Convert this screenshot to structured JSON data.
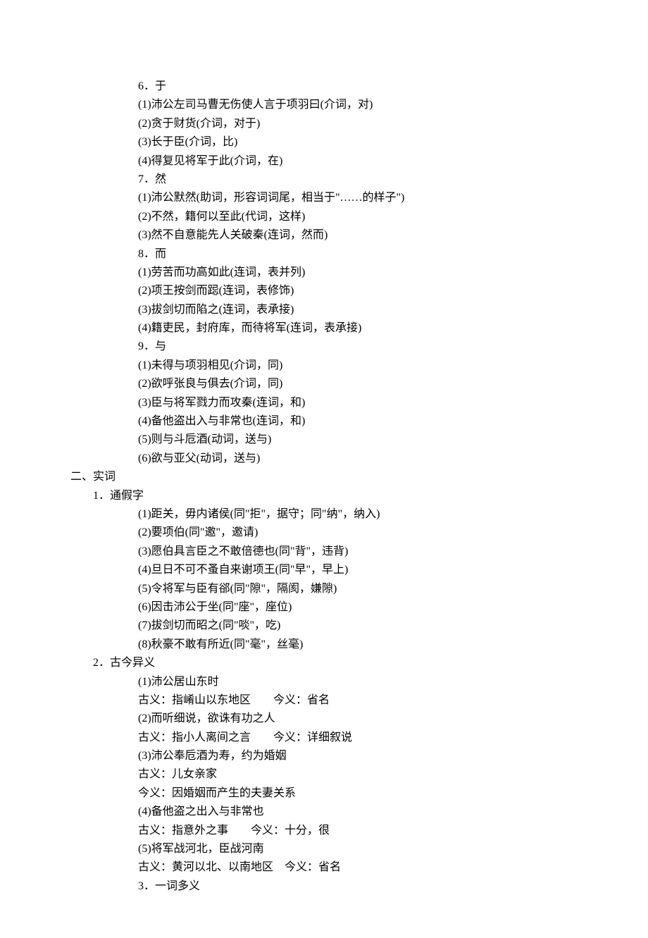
{
  "lines": [
    {
      "indent": 3,
      "text": "6．于"
    },
    {
      "indent": 3,
      "text": "(1)沛公左司马曹无伤使人言于项羽曰(介词，对)"
    },
    {
      "indent": 3,
      "text": "(2)贪于财货(介词，对于)"
    },
    {
      "indent": 3,
      "text": "(3)长于臣(介词，比)"
    },
    {
      "indent": 3,
      "text": "(4)得复见将军于此(介词，在)"
    },
    {
      "indent": 3,
      "text": "7．然"
    },
    {
      "indent": 3,
      "text": "(1)沛公默然(助词，形容词词尾，相当于\"……的样子\")"
    },
    {
      "indent": 3,
      "text": "(2)不然，籍何以至此(代词，这样)"
    },
    {
      "indent": 3,
      "text": "(3)然不自意能先人关破秦(连词，然而)"
    },
    {
      "indent": 3,
      "text": "8．而"
    },
    {
      "indent": 3,
      "text": "(1)劳苦而功高如此(连词，表并列)"
    },
    {
      "indent": 3,
      "text": "(2)项王按剑而跽(连词，表修饰)"
    },
    {
      "indent": 3,
      "text": "(3)拔剑切而陷之(连词，表承接)"
    },
    {
      "indent": 3,
      "text": "(4)籍吏民，封府库，而待将军(连词，表承接)"
    },
    {
      "indent": 3,
      "text": "9．与"
    },
    {
      "indent": 3,
      "text": "(1)未得与项羽相见(介词，同)"
    },
    {
      "indent": 3,
      "text": "(2)欲呼张良与俱去(介词，同)"
    },
    {
      "indent": 3,
      "text": "(3)臣与将军戮力而攻秦(连词，和)"
    },
    {
      "indent": 3,
      "text": "(4)备他盗出入与非常也(连词，和)"
    },
    {
      "indent": 3,
      "text": "(5)则与斗卮酒(动词，送与)"
    },
    {
      "indent": 3,
      "text": "(6)欲与亚父(动词，送与)"
    },
    {
      "indent": 0,
      "text": "二、实词"
    },
    {
      "indent": 1,
      "text": "1．通假字"
    },
    {
      "indent": 3,
      "text": "(1)距关，毋内诸侯(同\"拒\"，据守；同\"纳\"，纳入)"
    },
    {
      "indent": 3,
      "text": "(2)要项伯(同\"邀\"，邀请)"
    },
    {
      "indent": 3,
      "text": "(3)愿伯具言臣之不敢倍德也(同\"背\"，违背)"
    },
    {
      "indent": 3,
      "text": "(4)旦日不可不蚤自来谢项王(同\"早\"，早上)"
    },
    {
      "indent": 3,
      "text": "(5)令将军与臣有郤(同\"隙\"，隔阂，嫌隙)"
    },
    {
      "indent": 3,
      "text": "(6)因击沛公于坐(同\"座\"，座位)"
    },
    {
      "indent": 3,
      "text": "(7)拔剑切而昭之(同\"啖\"，吃)"
    },
    {
      "indent": 3,
      "text": "(8)秋豪不敢有所近(同\"毫\"，丝毫)"
    },
    {
      "indent": 1,
      "text": "2．古今异义"
    },
    {
      "indent": 3,
      "text": "(1)沛公居山东时"
    },
    {
      "indent": 3,
      "text": "古义：指崤山以东地区        今义：省名"
    },
    {
      "indent": 3,
      "text": "(2)而听细说，欲诛有功之人"
    },
    {
      "indent": 3,
      "text": "古义：指小人离间之言        今义：详细叙说"
    },
    {
      "indent": 3,
      "text": "(3)沛公奉卮酒为寿，约为婚姻"
    },
    {
      "indent": 3,
      "text": "古义：儿女亲家"
    },
    {
      "indent": 3,
      "text": "今义：因婚姻而产生的夫妻关系"
    },
    {
      "indent": 3,
      "text": "(4)备他盗之出入与非常也"
    },
    {
      "indent": 3,
      "text": "古义：指意外之事        今义：十分，很"
    },
    {
      "indent": 3,
      "text": "(5)将军战河北，臣战河南"
    },
    {
      "indent": 3,
      "text": "古义：黄河以北、以南地区    今义：省名"
    },
    {
      "indent": 3,
      "text": "3．一词多义"
    }
  ]
}
